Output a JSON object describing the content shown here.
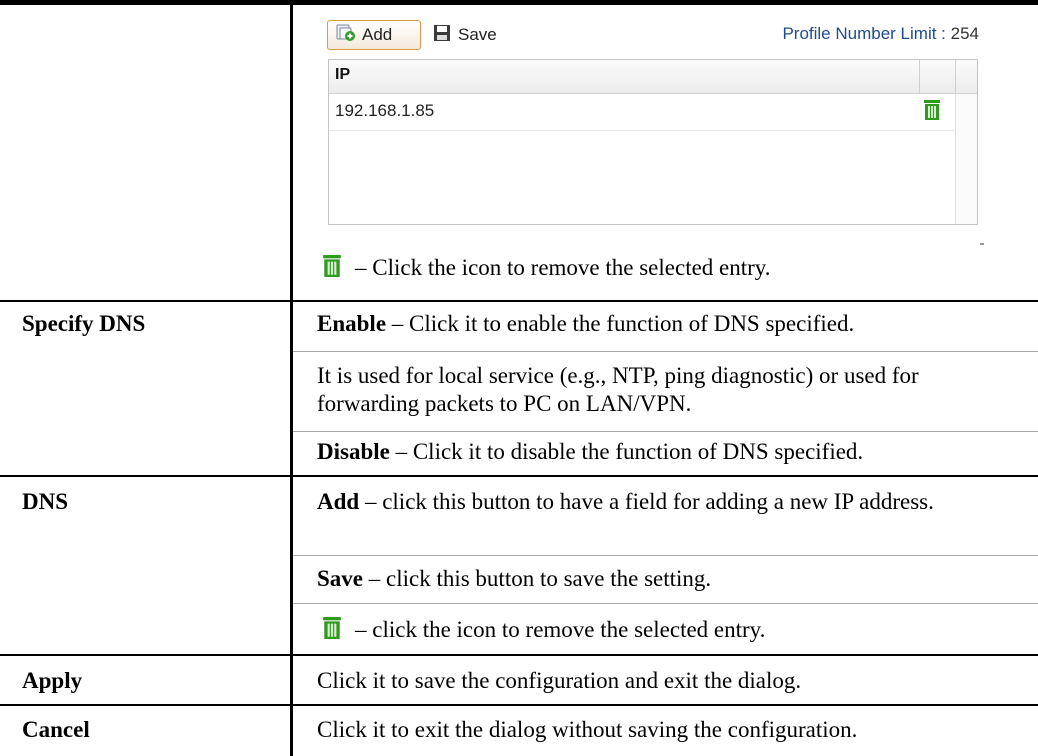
{
  "panel": {
    "add_label": "Add",
    "save_label": "Save",
    "limit_label": "Profile Number Limit : ",
    "limit_value": "254",
    "column_header": "IP",
    "rows": [
      {
        "ip": "192.168.1.85"
      }
    ]
  },
  "row0": {
    "icon_text": "– Click the icon to remove the selected entry."
  },
  "specify_dns": {
    "label": "Specify DNS",
    "enable_term": "Enable",
    "enable_text": " – Click it to enable the function of DNS specified.",
    "note": "It is used for local service (e.g., NTP, ping diagnostic) or used for forwarding packets to PC on LAN/VPN.",
    "disable_term": "Disable",
    "disable_text": " – Click it to disable the function of DNS specified."
  },
  "dns": {
    "label": "DNS",
    "add_term": "Add",
    "add_text": " – click this button to have a field for adding a new IP address.",
    "save_term": "Save",
    "save_text": " – click this button to save the setting.",
    "icon_text": "– click the icon to remove the selected entry."
  },
  "apply": {
    "label": "Apply",
    "text": "Click it to save the configuration and exit the dialog."
  },
  "cancel": {
    "label": "Cancel",
    "text": "Click it to exit the dialog without saving the configuration."
  },
  "colors": {
    "trash_green": "#2e9a1e",
    "limit_blue": "#1f4c8a",
    "add_border": "#d89a45"
  },
  "icons": [
    "add-icon",
    "save-icon",
    "trash-icon"
  ]
}
